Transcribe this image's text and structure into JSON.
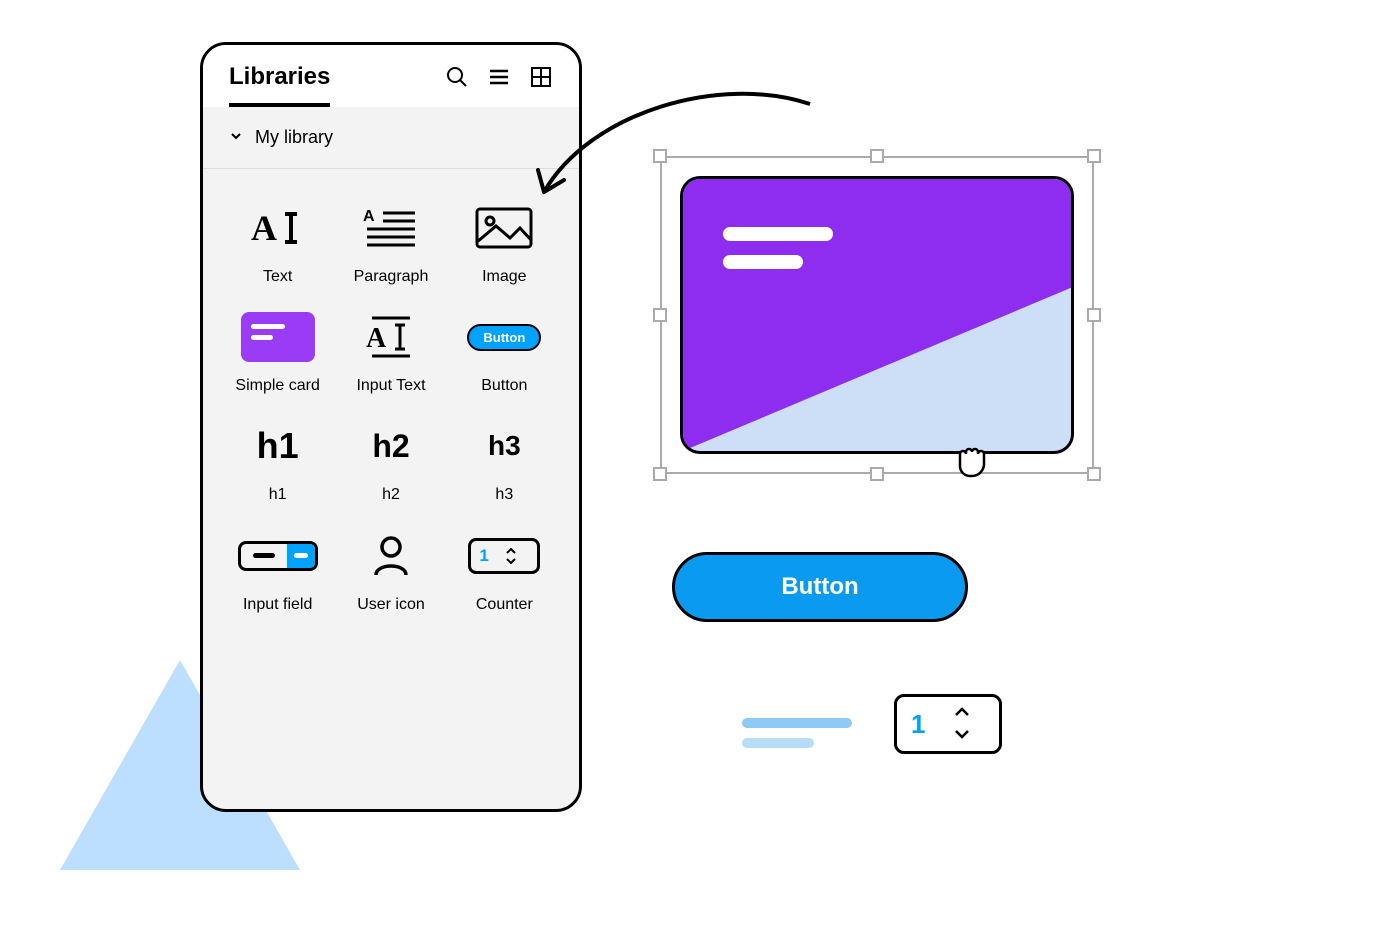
{
  "panel": {
    "title": "Libraries",
    "section": "My library",
    "items": [
      {
        "label": "Text"
      },
      {
        "label": "Paragraph"
      },
      {
        "label": "Image"
      },
      {
        "label": "Simple card"
      },
      {
        "label": "Input Text"
      },
      {
        "label": "Button",
        "button_text": "Button"
      },
      {
        "label": "h1",
        "symbol": "h1"
      },
      {
        "label": "h2",
        "symbol": "h2"
      },
      {
        "label": "h3",
        "symbol": "h3"
      },
      {
        "label": "Input field"
      },
      {
        "label": "User icon"
      },
      {
        "label": "Counter",
        "value": "1"
      }
    ]
  },
  "canvas": {
    "button_label": "Button",
    "counter_value": "1"
  },
  "colors": {
    "accent_blue": "#00a2ff",
    "accent_purple": "#8e2cf0",
    "light_blue": "#bcdeff"
  }
}
